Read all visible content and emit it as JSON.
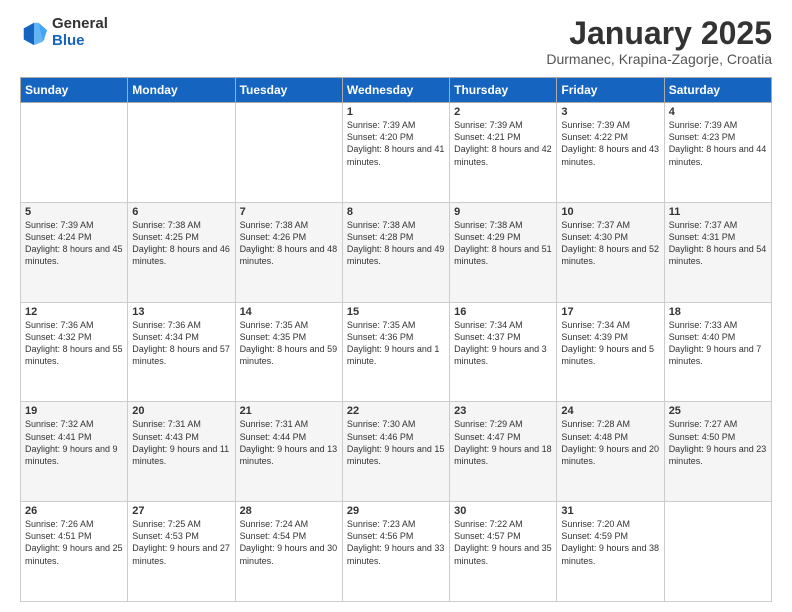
{
  "header": {
    "logo_general": "General",
    "logo_blue": "Blue",
    "month_title": "January 2025",
    "location": "Durmanec, Krapina-Zagorje, Croatia"
  },
  "days_of_week": [
    "Sunday",
    "Monday",
    "Tuesday",
    "Wednesday",
    "Thursday",
    "Friday",
    "Saturday"
  ],
  "weeks": [
    {
      "cells": [
        {
          "day": "",
          "content": ""
        },
        {
          "day": "",
          "content": ""
        },
        {
          "day": "",
          "content": ""
        },
        {
          "day": "1",
          "content": "Sunrise: 7:39 AM\nSunset: 4:20 PM\nDaylight: 8 hours and 41 minutes."
        },
        {
          "day": "2",
          "content": "Sunrise: 7:39 AM\nSunset: 4:21 PM\nDaylight: 8 hours and 42 minutes."
        },
        {
          "day": "3",
          "content": "Sunrise: 7:39 AM\nSunset: 4:22 PM\nDaylight: 8 hours and 43 minutes."
        },
        {
          "day": "4",
          "content": "Sunrise: 7:39 AM\nSunset: 4:23 PM\nDaylight: 8 hours and 44 minutes."
        }
      ]
    },
    {
      "cells": [
        {
          "day": "5",
          "content": "Sunrise: 7:39 AM\nSunset: 4:24 PM\nDaylight: 8 hours and 45 minutes."
        },
        {
          "day": "6",
          "content": "Sunrise: 7:38 AM\nSunset: 4:25 PM\nDaylight: 8 hours and 46 minutes."
        },
        {
          "day": "7",
          "content": "Sunrise: 7:38 AM\nSunset: 4:26 PM\nDaylight: 8 hours and 48 minutes."
        },
        {
          "day": "8",
          "content": "Sunrise: 7:38 AM\nSunset: 4:28 PM\nDaylight: 8 hours and 49 minutes."
        },
        {
          "day": "9",
          "content": "Sunrise: 7:38 AM\nSunset: 4:29 PM\nDaylight: 8 hours and 51 minutes."
        },
        {
          "day": "10",
          "content": "Sunrise: 7:37 AM\nSunset: 4:30 PM\nDaylight: 8 hours and 52 minutes."
        },
        {
          "day": "11",
          "content": "Sunrise: 7:37 AM\nSunset: 4:31 PM\nDaylight: 8 hours and 54 minutes."
        }
      ]
    },
    {
      "cells": [
        {
          "day": "12",
          "content": "Sunrise: 7:36 AM\nSunset: 4:32 PM\nDaylight: 8 hours and 55 minutes."
        },
        {
          "day": "13",
          "content": "Sunrise: 7:36 AM\nSunset: 4:34 PM\nDaylight: 8 hours and 57 minutes."
        },
        {
          "day": "14",
          "content": "Sunrise: 7:35 AM\nSunset: 4:35 PM\nDaylight: 8 hours and 59 minutes."
        },
        {
          "day": "15",
          "content": "Sunrise: 7:35 AM\nSunset: 4:36 PM\nDaylight: 9 hours and 1 minute."
        },
        {
          "day": "16",
          "content": "Sunrise: 7:34 AM\nSunset: 4:37 PM\nDaylight: 9 hours and 3 minutes."
        },
        {
          "day": "17",
          "content": "Sunrise: 7:34 AM\nSunset: 4:39 PM\nDaylight: 9 hours and 5 minutes."
        },
        {
          "day": "18",
          "content": "Sunrise: 7:33 AM\nSunset: 4:40 PM\nDaylight: 9 hours and 7 minutes."
        }
      ]
    },
    {
      "cells": [
        {
          "day": "19",
          "content": "Sunrise: 7:32 AM\nSunset: 4:41 PM\nDaylight: 9 hours and 9 minutes."
        },
        {
          "day": "20",
          "content": "Sunrise: 7:31 AM\nSunset: 4:43 PM\nDaylight: 9 hours and 11 minutes."
        },
        {
          "day": "21",
          "content": "Sunrise: 7:31 AM\nSunset: 4:44 PM\nDaylight: 9 hours and 13 minutes."
        },
        {
          "day": "22",
          "content": "Sunrise: 7:30 AM\nSunset: 4:46 PM\nDaylight: 9 hours and 15 minutes."
        },
        {
          "day": "23",
          "content": "Sunrise: 7:29 AM\nSunset: 4:47 PM\nDaylight: 9 hours and 18 minutes."
        },
        {
          "day": "24",
          "content": "Sunrise: 7:28 AM\nSunset: 4:48 PM\nDaylight: 9 hours and 20 minutes."
        },
        {
          "day": "25",
          "content": "Sunrise: 7:27 AM\nSunset: 4:50 PM\nDaylight: 9 hours and 23 minutes."
        }
      ]
    },
    {
      "cells": [
        {
          "day": "26",
          "content": "Sunrise: 7:26 AM\nSunset: 4:51 PM\nDaylight: 9 hours and 25 minutes."
        },
        {
          "day": "27",
          "content": "Sunrise: 7:25 AM\nSunset: 4:53 PM\nDaylight: 9 hours and 27 minutes."
        },
        {
          "day": "28",
          "content": "Sunrise: 7:24 AM\nSunset: 4:54 PM\nDaylight: 9 hours and 30 minutes."
        },
        {
          "day": "29",
          "content": "Sunrise: 7:23 AM\nSunset: 4:56 PM\nDaylight: 9 hours and 33 minutes."
        },
        {
          "day": "30",
          "content": "Sunrise: 7:22 AM\nSunset: 4:57 PM\nDaylight: 9 hours and 35 minutes."
        },
        {
          "day": "31",
          "content": "Sunrise: 7:20 AM\nSunset: 4:59 PM\nDaylight: 9 hours and 38 minutes."
        },
        {
          "day": "",
          "content": ""
        }
      ]
    }
  ]
}
